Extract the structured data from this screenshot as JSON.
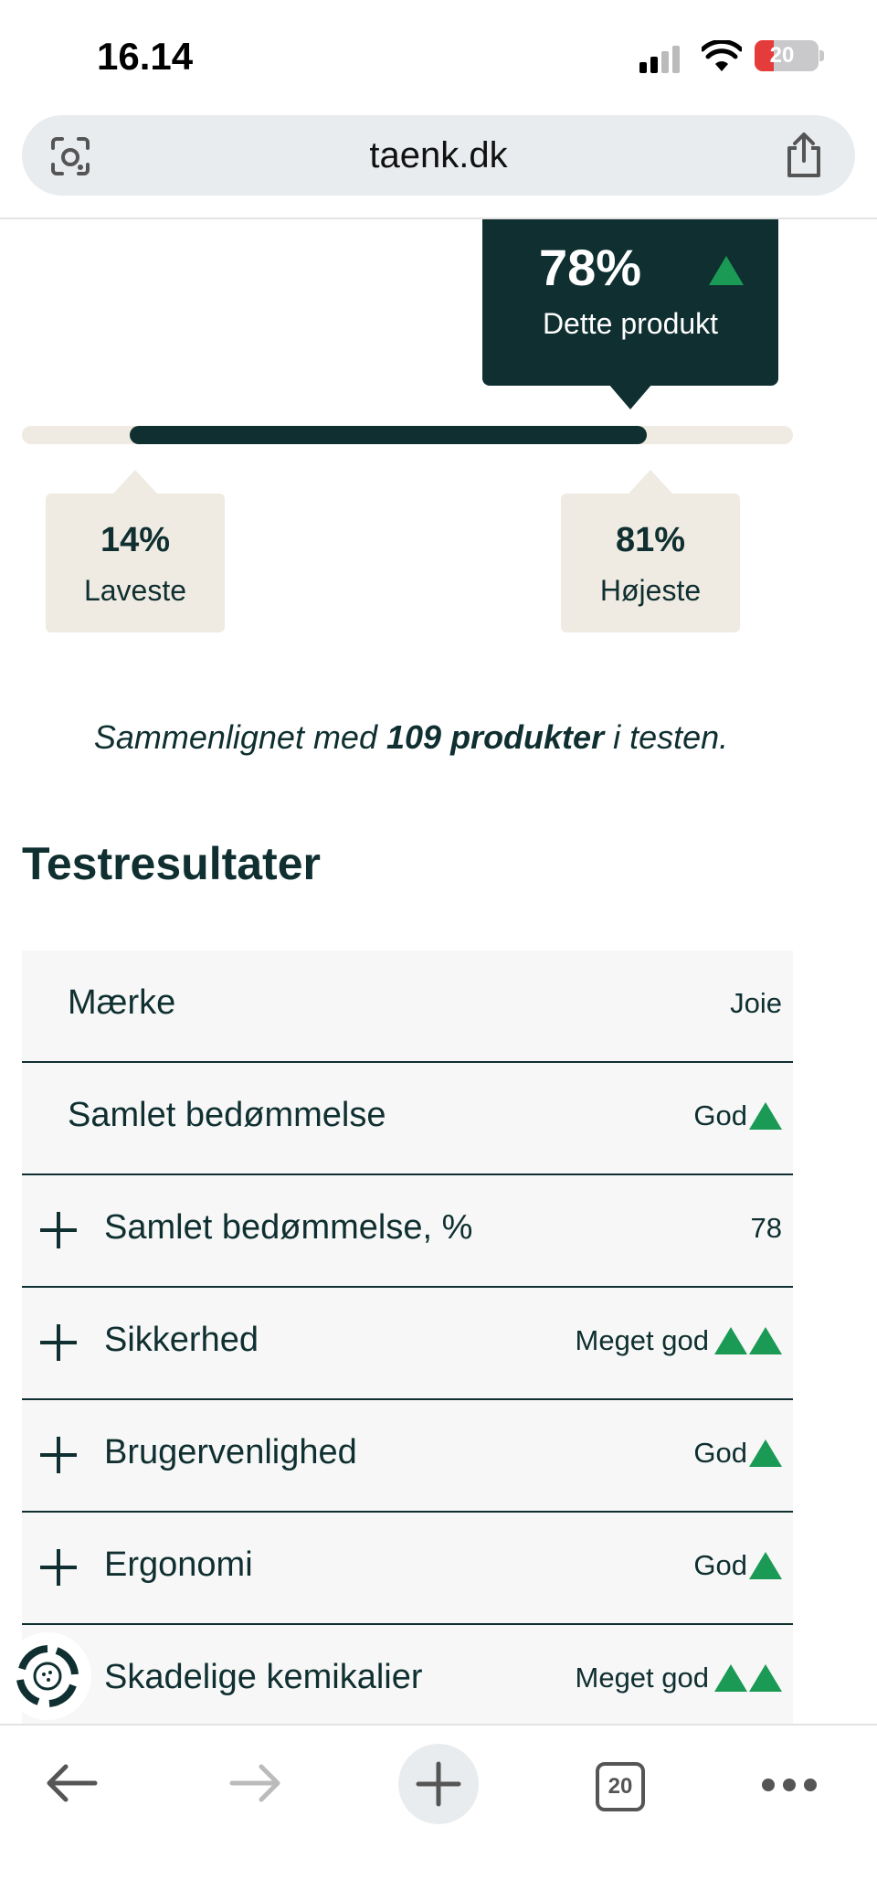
{
  "status_bar": {
    "time": "16.14",
    "battery": "20"
  },
  "browser": {
    "url": "taenk.dk",
    "tab_count": "20"
  },
  "score": {
    "this_product_value": "78%",
    "this_product_label": "Dette produkt",
    "lowest_value": "14%",
    "lowest_label": "Laveste",
    "highest_value": "81%",
    "highest_label": "Højeste",
    "compared_prefix": "Sammenlignet med",
    "compared_count": "109 produkter",
    "compared_suffix": "i testen."
  },
  "results": {
    "heading": "Testresultater",
    "rows": [
      {
        "label": "Mærke",
        "value": "Joie",
        "expandable": false,
        "rating_icons": 0
      },
      {
        "label": "Samlet bedømmelse",
        "value": "God",
        "expandable": false,
        "rating_icons": 1
      },
      {
        "label": "Samlet bedømmelse, %",
        "value": "78",
        "expandable": true,
        "rating_icons": 0
      },
      {
        "label": "Sikkerhed",
        "value": "Meget god",
        "expandable": true,
        "rating_icons": 2
      },
      {
        "label": "Brugervenlighed",
        "value": "God",
        "expandable": true,
        "rating_icons": 1
      },
      {
        "label": "Ergonomi",
        "value": "God",
        "expandable": true,
        "rating_icons": 1
      },
      {
        "label": "Skadelige kemikalier",
        "value": "Meget god",
        "expandable": true,
        "rating_icons": 2
      }
    ]
  },
  "colors": {
    "primary": "#0f2f30",
    "rating_green": "#1a9a55",
    "beige": "#efebe3"
  }
}
